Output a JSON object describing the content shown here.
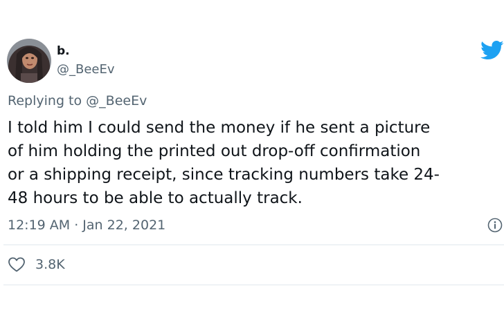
{
  "author": {
    "display_name": "b.",
    "handle": "@_BeeEv",
    "avatar_icon": "profile-photo"
  },
  "brand": {
    "icon": "twitter-bird-icon",
    "color": "#1da1f2"
  },
  "reply": {
    "text": "Replying to @_BeeEv"
  },
  "tweet": {
    "lines": [
      "I told him I could send the money if he sent a picture",
      "of him holding the printed out drop-off confirmation",
      "or a shipping receipt, since tracking numbers take 24-",
      "48 hours to be able to actually track."
    ],
    "timestamp": "12:19 AM · Jan 22, 2021"
  },
  "actions": {
    "like_icon": "heart-icon",
    "like_count": "3.8K",
    "info_icon": "info-icon"
  },
  "colors": {
    "secondary_text": "#536471",
    "divider": "#e1e8ed",
    "text": "#0f1419"
  }
}
